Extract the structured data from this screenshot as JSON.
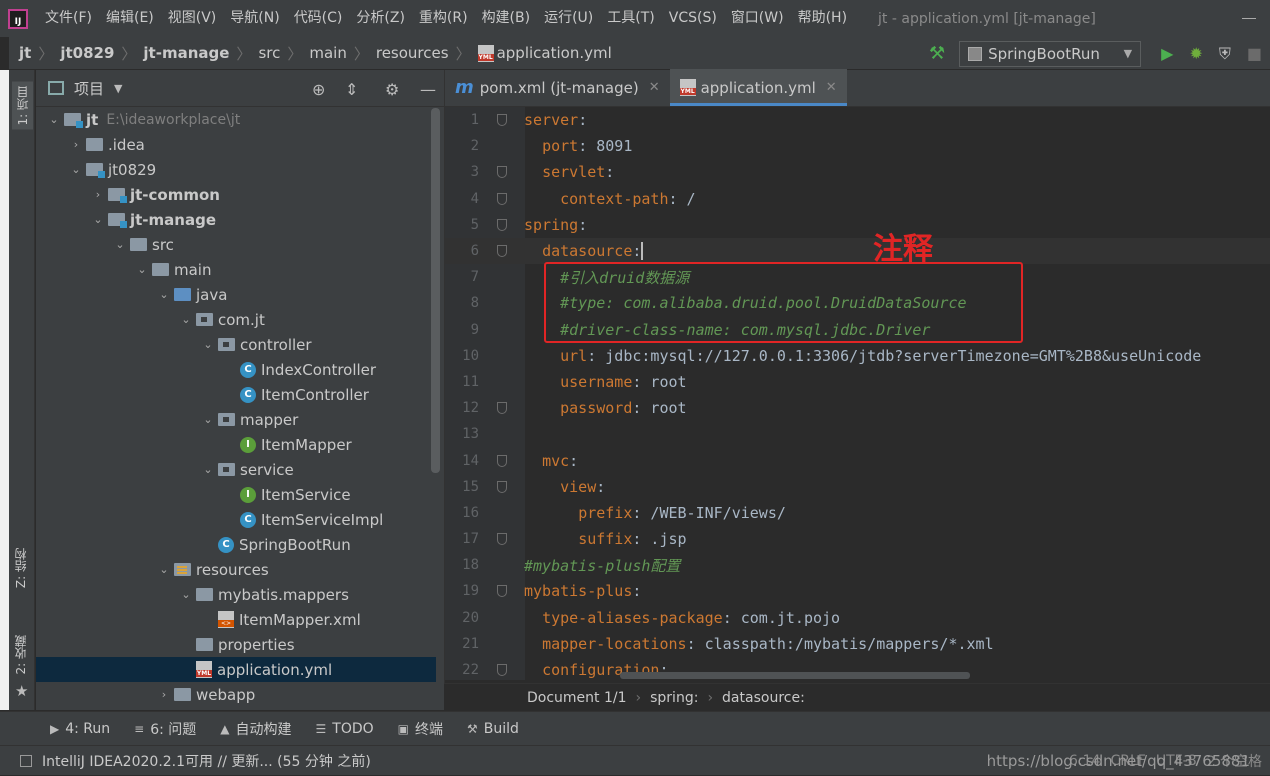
{
  "window": {
    "title": "jt - application.yml [jt-manage]"
  },
  "menu": {
    "items": [
      "文件(F)",
      "编辑(E)",
      "视图(V)",
      "导航(N)",
      "代码(C)",
      "分析(Z)",
      "重构(R)",
      "构建(B)",
      "运行(U)",
      "工具(T)",
      "VCS(S)",
      "窗口(W)",
      "帮助(H)"
    ]
  },
  "breadcrumb": {
    "items": [
      "jt",
      "jt0829",
      "jt-manage",
      "src",
      "main",
      "resources",
      "application.yml"
    ]
  },
  "run": {
    "config": "SpringBootRun"
  },
  "left_strip": {
    "project": "1: 项目",
    "structure": "Z: 结构",
    "favorites": "2: 收藏"
  },
  "project_panel": {
    "title": "项目",
    "tree": [
      {
        "label": "jt",
        "path": "E:\\ideaworkplace\\jt",
        "depth": 0,
        "arrow": "open",
        "icon": "folder-module",
        "bold": true
      },
      {
        "label": ".idea",
        "depth": 1,
        "arrow": "closed",
        "icon": "folder"
      },
      {
        "label": "jt0829",
        "depth": 1,
        "arrow": "open",
        "icon": "folder-module"
      },
      {
        "label": "jt-common",
        "depth": 2,
        "arrow": "closed",
        "icon": "folder-module",
        "bold": true
      },
      {
        "label": "jt-manage",
        "depth": 2,
        "arrow": "open",
        "icon": "folder-module",
        "bold": true
      },
      {
        "label": "src",
        "depth": 3,
        "arrow": "open",
        "icon": "folder"
      },
      {
        "label": "main",
        "depth": 4,
        "arrow": "open",
        "icon": "folder"
      },
      {
        "label": "java",
        "depth": 5,
        "arrow": "open",
        "icon": "folder-blue"
      },
      {
        "label": "com.jt",
        "depth": 6,
        "arrow": "open",
        "icon": "package"
      },
      {
        "label": "controller",
        "depth": 7,
        "arrow": "open",
        "icon": "package"
      },
      {
        "label": "IndexController",
        "depth": 8,
        "arrow": "none",
        "icon": "class"
      },
      {
        "label": "ItemController",
        "depth": 8,
        "arrow": "none",
        "icon": "class"
      },
      {
        "label": "mapper",
        "depth": 7,
        "arrow": "open",
        "icon": "package"
      },
      {
        "label": "ItemMapper",
        "depth": 8,
        "arrow": "none",
        "icon": "interface"
      },
      {
        "label": "service",
        "depth": 7,
        "arrow": "open",
        "icon": "package"
      },
      {
        "label": "ItemService",
        "depth": 8,
        "arrow": "none",
        "icon": "interface"
      },
      {
        "label": "ItemServiceImpl",
        "depth": 8,
        "arrow": "none",
        "icon": "class"
      },
      {
        "label": "SpringBootRun",
        "depth": 7,
        "arrow": "none",
        "icon": "class"
      },
      {
        "label": "resources",
        "depth": 5,
        "arrow": "open",
        "icon": "folder-resources"
      },
      {
        "label": "mybatis.mappers",
        "depth": 6,
        "arrow": "open",
        "icon": "folder"
      },
      {
        "label": "ItemMapper.xml",
        "depth": 7,
        "arrow": "none",
        "icon": "xml"
      },
      {
        "label": "properties",
        "depth": 6,
        "arrow": "none",
        "icon": "folder"
      },
      {
        "label": "application.yml",
        "depth": 6,
        "arrow": "none",
        "icon": "yml",
        "selected": true
      },
      {
        "label": "webapp",
        "depth": 5,
        "arrow": "closed",
        "icon": "folder"
      }
    ]
  },
  "editor": {
    "tabs": [
      {
        "label": "pom.xml (jt-manage)",
        "icon": "m",
        "active": false
      },
      {
        "label": "application.yml",
        "icon": "yml",
        "active": true
      }
    ],
    "lines": [
      {
        "n": "1",
        "indent": "",
        "key": "server",
        "val": "",
        "fold": true
      },
      {
        "n": "2",
        "indent": "  ",
        "key": "port",
        "val": " 8091"
      },
      {
        "n": "3",
        "indent": "  ",
        "key": "servlet",
        "val": "",
        "fold": true
      },
      {
        "n": "4",
        "indent": "    ",
        "key": "context-path",
        "val": " /",
        "fold": true
      },
      {
        "n": "5",
        "indent": "",
        "key": "spring",
        "val": "",
        "fold": true
      },
      {
        "n": "6",
        "indent": "  ",
        "key": "datasource",
        "val": "",
        "fold": true,
        "current": true
      },
      {
        "n": "7",
        "indent": "    ",
        "comment": "#引入druid数据源"
      },
      {
        "n": "8",
        "indent": "    ",
        "comment": "#type: com.alibaba.druid.pool.DruidDataSource"
      },
      {
        "n": "9",
        "indent": "    ",
        "comment": "#driver-class-name: com.mysql.jdbc.Driver"
      },
      {
        "n": "10",
        "indent": "    ",
        "key": "url",
        "val": " jdbc:mysql://127.0.0.1:3306/jtdb?serverTimezone=GMT%2B8&useUnicode"
      },
      {
        "n": "11",
        "indent": "    ",
        "key": "username",
        "val": " root"
      },
      {
        "n": "12",
        "indent": "    ",
        "key": "password",
        "val": " root",
        "fold": true
      },
      {
        "n": "13",
        "indent": "",
        "key": "",
        "val": ""
      },
      {
        "n": "14",
        "indent": "  ",
        "key": "mvc",
        "val": "",
        "fold": true
      },
      {
        "n": "15",
        "indent": "    ",
        "key": "view",
        "val": "",
        "fold": true
      },
      {
        "n": "16",
        "indent": "      ",
        "key": "prefix",
        "val": " /WEB-INF/views/"
      },
      {
        "n": "17",
        "indent": "      ",
        "key": "suffix",
        "val": " .jsp",
        "fold": true
      },
      {
        "n": "18",
        "indent": "",
        "comment": "#mybatis-plush配置"
      },
      {
        "n": "19",
        "indent": "",
        "key": "mybatis-plus",
        "val": "",
        "fold": true
      },
      {
        "n": "20",
        "indent": "  ",
        "key": "type-aliases-package",
        "val": " com.jt.pojo"
      },
      {
        "n": "21",
        "indent": "  ",
        "key": "mapper-locations",
        "val": " classpath:/mybatis/mappers/*.xml"
      },
      {
        "n": "22",
        "indent": "  ",
        "key": "configuration",
        "val": "",
        "fold": true
      }
    ]
  },
  "annotation": {
    "label": "注释",
    "color": "#e12525"
  },
  "editor_breadcrumb": {
    "items": [
      "Document 1/1",
      "spring:",
      "datasource:"
    ]
  },
  "tool_windows": [
    {
      "icon": "play-icon",
      "label": "4: Run"
    },
    {
      "icon": "list-icon",
      "label": "6: 问题"
    },
    {
      "icon": "warning-icon",
      "label": "自动构建"
    },
    {
      "icon": "todo-icon",
      "label": "TODO"
    },
    {
      "icon": "terminal-icon",
      "label": "终端"
    },
    {
      "icon": "hammer-icon",
      "label": "Build"
    }
  ],
  "status": {
    "message": "IntelliJ IDEA2020.2.1可用 // 更新... (55 分钟 之前)",
    "position": "6:14",
    "line_sep": "CRLF",
    "encoding": "UTF-8",
    "indent": "2 个空格",
    "watermark": "https://blog.csdn.net/qq_43765881"
  },
  "colors": {
    "key": "#cc7832",
    "comment": "#629755",
    "value": "#a9b7c6",
    "selection": "#0d293e"
  }
}
